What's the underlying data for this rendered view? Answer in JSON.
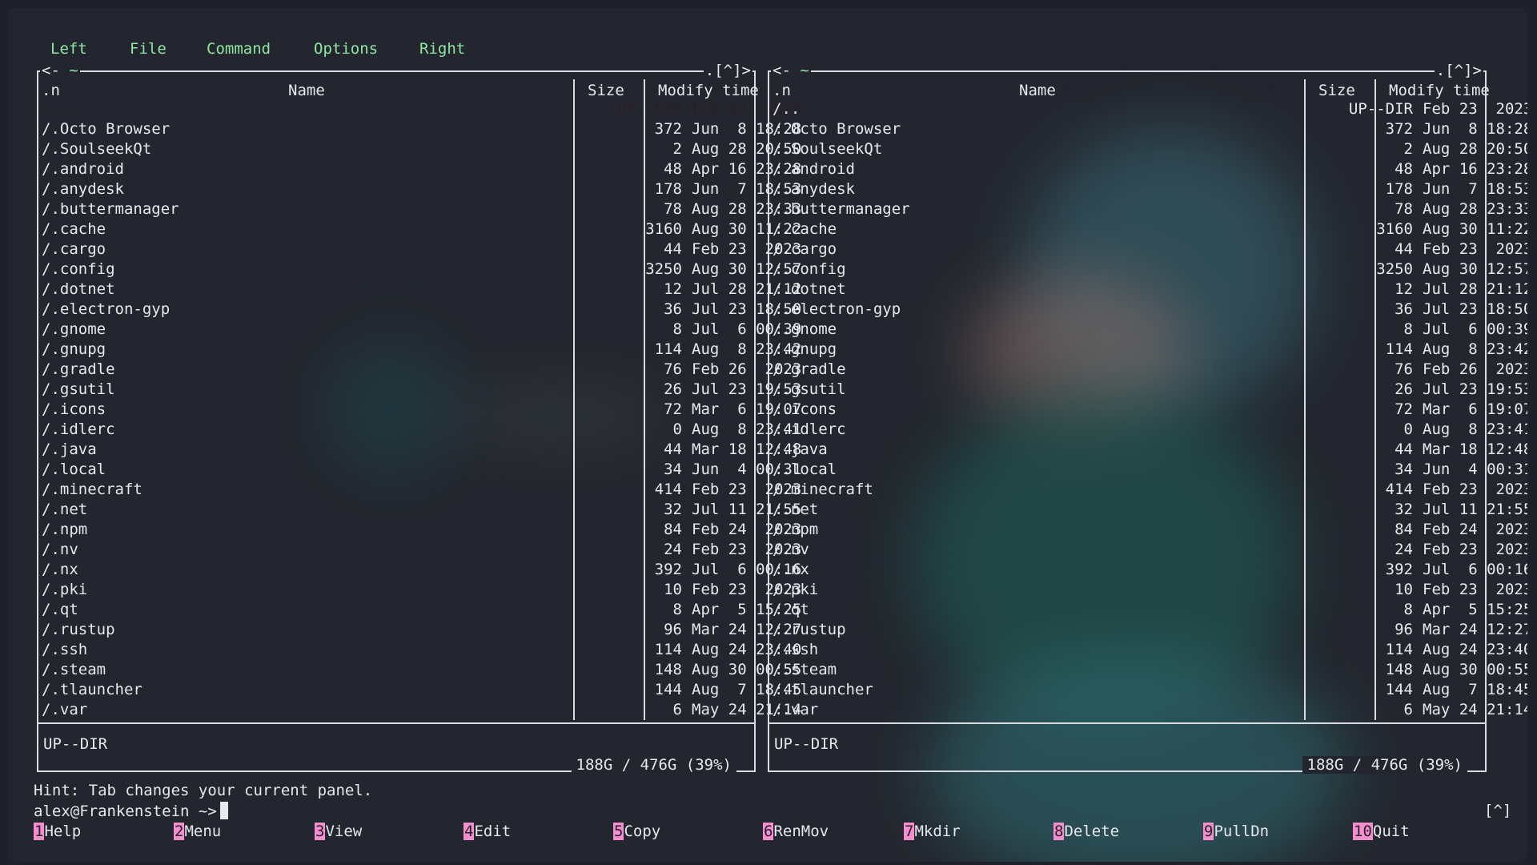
{
  "menu": [
    "Left",
    "File",
    "Command",
    "Options",
    "Right"
  ],
  "panels": [
    {
      "path_left": "<- ",
      "path_tilde": "~",
      "path_right": ".[^]>",
      "col_sort": ".n",
      "col_name": "Name",
      "col_size": "Size",
      "col_time": "Modify time",
      "status": "UP--DIR",
      "free_space": "188G / 476G (39%)",
      "rows": [
        {
          "name": "/..",
          "size": "UP--DIR",
          "time": "Feb 23  2023",
          "selected": true
        },
        {
          "name": "/.Octo Browser",
          "size": "372",
          "time": "Jun  8 18:28"
        },
        {
          "name": "/.SoulseekQt",
          "size": "2",
          "time": "Aug 28 20:50"
        },
        {
          "name": "/.android",
          "size": "48",
          "time": "Apr 16 23:28"
        },
        {
          "name": "/.anydesk",
          "size": "178",
          "time": "Jun  7 18:53"
        },
        {
          "name": "/.buttermanager",
          "size": "78",
          "time": "Aug 28 23:33"
        },
        {
          "name": "/.cache",
          "size": "3160",
          "time": "Aug 30 11:22"
        },
        {
          "name": "/.cargo",
          "size": "44",
          "time": "Feb 23  2023"
        },
        {
          "name": "/.config",
          "size": "3250",
          "time": "Aug 30 12:57"
        },
        {
          "name": "/.dotnet",
          "size": "12",
          "time": "Jul 28 21:12"
        },
        {
          "name": "/.electron-gyp",
          "size": "36",
          "time": "Jul 23 18:50"
        },
        {
          "name": "/.gnome",
          "size": "8",
          "time": "Jul  6 00:39"
        },
        {
          "name": "/.gnupg",
          "size": "114",
          "time": "Aug  8 23:42"
        },
        {
          "name": "/.gradle",
          "size": "76",
          "time": "Feb 26  2023"
        },
        {
          "name": "/.gsutil",
          "size": "26",
          "time": "Jul 23 19:53"
        },
        {
          "name": "/.icons",
          "size": "72",
          "time": "Mar  6 19:07"
        },
        {
          "name": "/.idlerc",
          "size": "0",
          "time": "Aug  8 23:41"
        },
        {
          "name": "/.java",
          "size": "44",
          "time": "Mar 18 12:48"
        },
        {
          "name": "/.local",
          "size": "34",
          "time": "Jun  4 00:31"
        },
        {
          "name": "/.minecraft",
          "size": "414",
          "time": "Feb 23  2023"
        },
        {
          "name": "/.net",
          "size": "32",
          "time": "Jul 11 21:55"
        },
        {
          "name": "/.npm",
          "size": "84",
          "time": "Feb 24  2023"
        },
        {
          "name": "/.nv",
          "size": "24",
          "time": "Feb 23  2023"
        },
        {
          "name": "/.nx",
          "size": "392",
          "time": "Jul  6 00:16"
        },
        {
          "name": "/.pki",
          "size": "10",
          "time": "Feb 23  2023"
        },
        {
          "name": "/.qt",
          "size": "8",
          "time": "Apr  5 15:25"
        },
        {
          "name": "/.rustup",
          "size": "96",
          "time": "Mar 24 12:27"
        },
        {
          "name": "/.ssh",
          "size": "114",
          "time": "Aug 24 23:40"
        },
        {
          "name": "/.steam",
          "size": "148",
          "time": "Aug 30 00:55"
        },
        {
          "name": "/.tlauncher",
          "size": "144",
          "time": "Aug  7 18:45"
        },
        {
          "name": "/.var",
          "size": "6",
          "time": "May 24 21:14"
        }
      ]
    },
    {
      "path_left": "<- ",
      "path_tilde": "~",
      "path_right": ".[^]>",
      "col_sort": ".n",
      "col_name": "Name",
      "col_size": "Size",
      "col_time": "Modify time",
      "status": "UP--DIR",
      "free_space": "188G / 476G (39%)",
      "rows": [
        {
          "name": "/..",
          "size": "UP--DIR",
          "time": "Feb 23  2023"
        },
        {
          "name": "/.Octo Browser",
          "size": "372",
          "time": "Jun  8 18:28"
        },
        {
          "name": "/.SoulseekQt",
          "size": "2",
          "time": "Aug 28 20:50"
        },
        {
          "name": "/.android",
          "size": "48",
          "time": "Apr 16 23:28"
        },
        {
          "name": "/.anydesk",
          "size": "178",
          "time": "Jun  7 18:53"
        },
        {
          "name": "/.buttermanager",
          "size": "78",
          "time": "Aug 28 23:33"
        },
        {
          "name": "/.cache",
          "size": "3160",
          "time": "Aug 30 11:22"
        },
        {
          "name": "/.cargo",
          "size": "44",
          "time": "Feb 23  2023"
        },
        {
          "name": "/.config",
          "size": "3250",
          "time": "Aug 30 12:57"
        },
        {
          "name": "/.dotnet",
          "size": "12",
          "time": "Jul 28 21:12"
        },
        {
          "name": "/.electron-gyp",
          "size": "36",
          "time": "Jul 23 18:50"
        },
        {
          "name": "/.gnome",
          "size": "8",
          "time": "Jul  6 00:39"
        },
        {
          "name": "/.gnupg",
          "size": "114",
          "time": "Aug  8 23:42"
        },
        {
          "name": "/.gradle",
          "size": "76",
          "time": "Feb 26  2023"
        },
        {
          "name": "/.gsutil",
          "size": "26",
          "time": "Jul 23 19:53"
        },
        {
          "name": "/.icons",
          "size": "72",
          "time": "Mar  6 19:07"
        },
        {
          "name": "/.idlerc",
          "size": "0",
          "time": "Aug  8 23:41"
        },
        {
          "name": "/.java",
          "size": "44",
          "time": "Mar 18 12:48"
        },
        {
          "name": "/.local",
          "size": "34",
          "time": "Jun  4 00:31"
        },
        {
          "name": "/.minecraft",
          "size": "414",
          "time": "Feb 23  2023"
        },
        {
          "name": "/.net",
          "size": "32",
          "time": "Jul 11 21:55"
        },
        {
          "name": "/.npm",
          "size": "84",
          "time": "Feb 24  2023"
        },
        {
          "name": "/.nv",
          "size": "24",
          "time": "Feb 23  2023"
        },
        {
          "name": "/.nx",
          "size": "392",
          "time": "Jul  6 00:16"
        },
        {
          "name": "/.pki",
          "size": "10",
          "time": "Feb 23  2023"
        },
        {
          "name": "/.qt",
          "size": "8",
          "time": "Apr  5 15:25"
        },
        {
          "name": "/.rustup",
          "size": "96",
          "time": "Mar 24 12:27"
        },
        {
          "name": "/.ssh",
          "size": "114",
          "time": "Aug 24 23:40"
        },
        {
          "name": "/.steam",
          "size": "148",
          "time": "Aug 30 00:55"
        },
        {
          "name": "/.tlauncher",
          "size": "144",
          "time": "Aug  7 18:45"
        },
        {
          "name": "/.var",
          "size": "6",
          "time": "May 24 21:14"
        }
      ]
    }
  ],
  "hint": "Hint: Tab changes your current panel.",
  "prompt": "alex@Frankenstein ~>",
  "caret_indicator": "[^]",
  "fkeys": [
    {
      "num": "1",
      "label": "Help"
    },
    {
      "num": "2",
      "label": "Menu"
    },
    {
      "num": "3",
      "label": "View"
    },
    {
      "num": "4",
      "label": "Edit"
    },
    {
      "num": "5",
      "label": "Copy"
    },
    {
      "num": "6",
      "label": "RenMov"
    },
    {
      "num": "7",
      "label": "Mkdir"
    },
    {
      "num": "8",
      "label": "Delete"
    },
    {
      "num": "9",
      "label": "PullDn"
    },
    {
      "num": "10",
      "label": "Quit"
    }
  ],
  "colors": {
    "background": "#23262e",
    "accent_pink": "#f48fcf",
    "menu_green": "#8ee6a3",
    "text": "#e6e8ee"
  }
}
